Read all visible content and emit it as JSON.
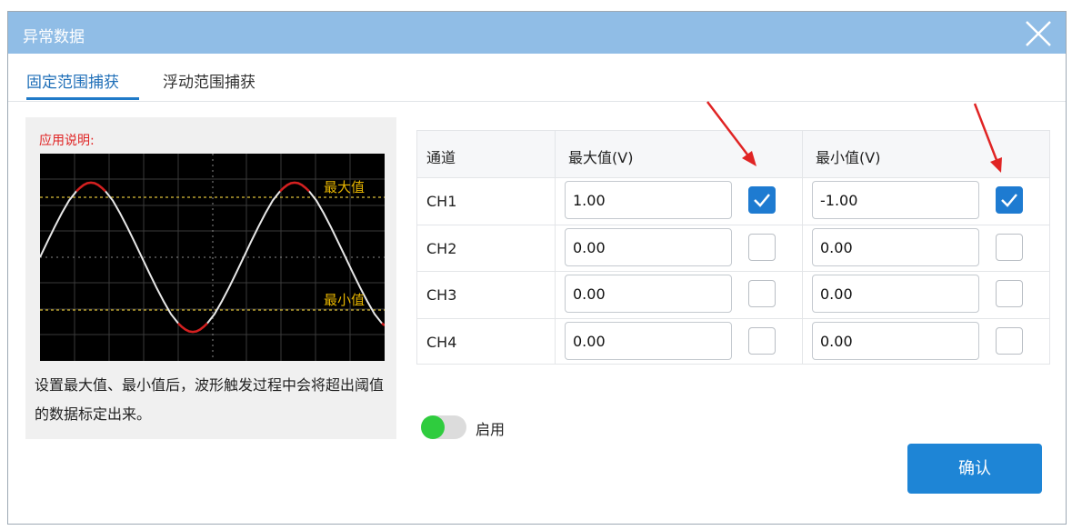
{
  "dialog": {
    "title": "异常数据"
  },
  "tabs": [
    {
      "label": "固定范围捕获",
      "active": true
    },
    {
      "label": "浮动范围捕获",
      "active": false
    }
  ],
  "help": {
    "title": "应用说明:",
    "max_label": "最大值",
    "min_label": "最小值",
    "description": "设置最大值、最小值后，波形触发过程中会将超出阈值的数据标定出来。"
  },
  "table": {
    "headers": [
      "通道",
      "最大值(V)",
      "最小值(V)"
    ],
    "rows": [
      {
        "channel": "CH1",
        "max": "1.00",
        "max_checked": true,
        "min": "-1.00",
        "min_checked": true
      },
      {
        "channel": "CH2",
        "max": "0.00",
        "max_checked": false,
        "min": "0.00",
        "min_checked": false
      },
      {
        "channel": "CH3",
        "max": "0.00",
        "max_checked": false,
        "min": "0.00",
        "min_checked": false
      },
      {
        "channel": "CH4",
        "max": "0.00",
        "max_checked": false,
        "min": "0.00",
        "min_checked": false
      }
    ]
  },
  "enable": {
    "label": "启用",
    "on": true
  },
  "confirm_label": "确认",
  "colors": {
    "accent": "#1e85d6",
    "title_bar": "#90bde6",
    "annotation_red": "#e02424",
    "toggle_on": "#2fcc3e"
  }
}
